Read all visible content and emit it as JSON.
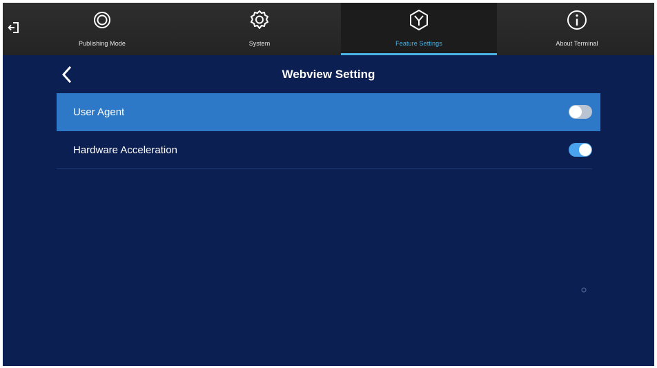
{
  "topbar": {
    "exit_icon": "exit-icon",
    "tabs": [
      {
        "label": "Publishing Mode",
        "icon": "publishing-mode-icon",
        "active": false
      },
      {
        "label": "System",
        "icon": "gear-icon",
        "active": false
      },
      {
        "label": "Feature Settings",
        "icon": "feature-settings-icon",
        "active": true
      },
      {
        "label": "About Terminal",
        "icon": "info-icon",
        "active": false
      }
    ]
  },
  "page": {
    "title": "Webview Setting",
    "back_icon": "chevron-left-icon"
  },
  "settings": [
    {
      "label": "User Agent",
      "enabled": false,
      "selected": true
    },
    {
      "label": "Hardware Acceleration",
      "enabled": true,
      "selected": false
    }
  ],
  "colors": {
    "background": "#0b1f52",
    "topbar": "#2e2e2e",
    "accent": "#4bb2e6",
    "selected_row": "#2e79c7",
    "toggle_on": "#4aa3ee",
    "toggle_off": "#b9c4d2"
  }
}
